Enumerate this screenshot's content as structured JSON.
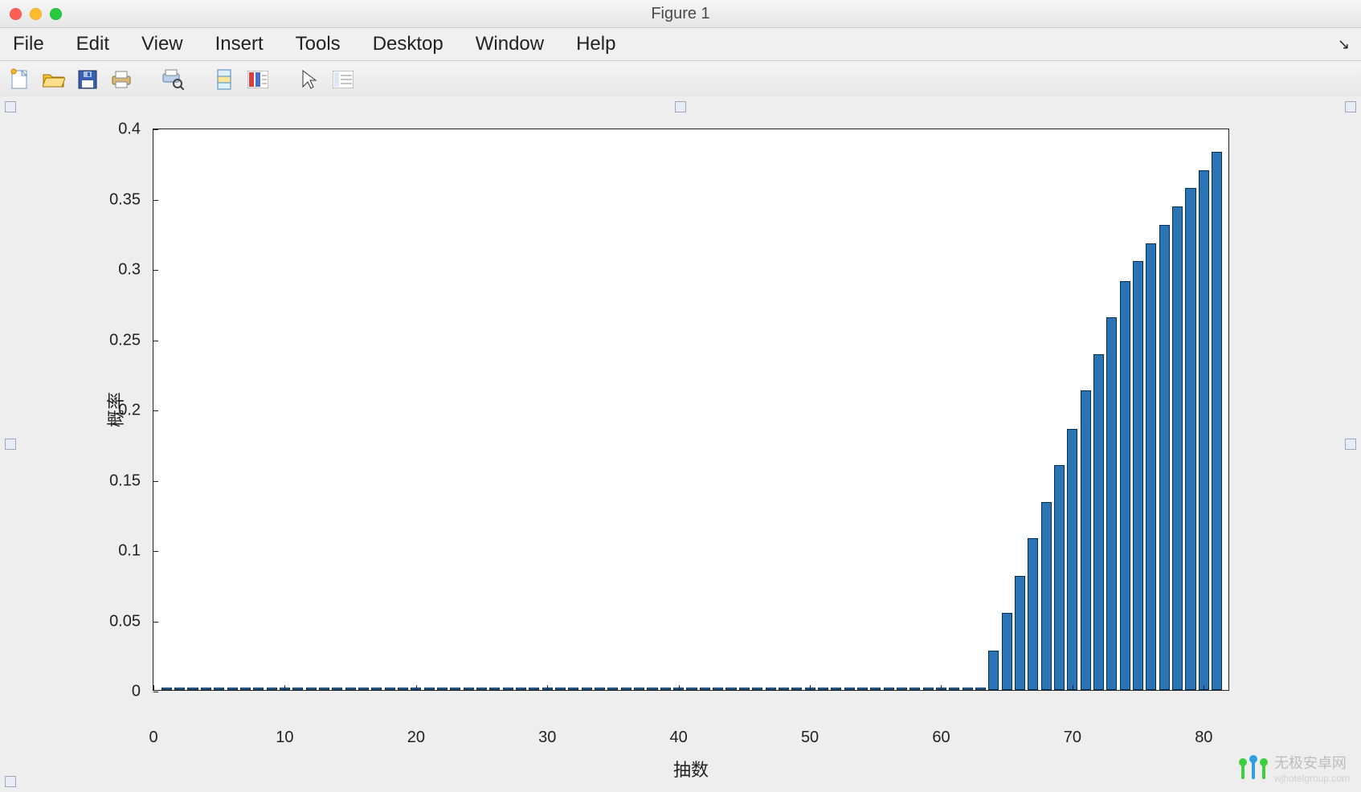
{
  "window": {
    "title": "Figure 1"
  },
  "menubar": {
    "items": [
      "File",
      "Edit",
      "View",
      "Insert",
      "Tools",
      "Desktop",
      "Window",
      "Help"
    ]
  },
  "toolbar": {
    "icons": [
      "new-figure-icon",
      "open-file-icon",
      "save-icon",
      "print-icon",
      "sep",
      "print-preview-icon",
      "sep",
      "link-plot-icon",
      "colorbar-icon",
      "sep",
      "cursor-icon",
      "plot-tools-icon"
    ]
  },
  "chart_data": {
    "type": "bar",
    "xlabel": "抽数",
    "ylabel": "概率",
    "xlim": [
      0,
      82
    ],
    "ylim": [
      0,
      0.4
    ],
    "xticks": [
      0,
      10,
      20,
      30,
      40,
      50,
      60,
      70,
      80
    ],
    "yticks": [
      0,
      0.05,
      0.1,
      0.15,
      0.2,
      0.25,
      0.3,
      0.35,
      0.4
    ],
    "bar_color": "#2a73b5",
    "categories": [
      1,
      2,
      3,
      4,
      5,
      6,
      7,
      8,
      9,
      10,
      11,
      12,
      13,
      14,
      15,
      16,
      17,
      18,
      19,
      20,
      21,
      22,
      23,
      24,
      25,
      26,
      27,
      28,
      29,
      30,
      31,
      32,
      33,
      34,
      35,
      36,
      37,
      38,
      39,
      40,
      41,
      42,
      43,
      44,
      45,
      46,
      47,
      48,
      49,
      50,
      51,
      52,
      53,
      54,
      55,
      56,
      57,
      58,
      59,
      60,
      61,
      62,
      63,
      64,
      65,
      66,
      67,
      68,
      69,
      70,
      71,
      72,
      73,
      74,
      75,
      76,
      77,
      78,
      79,
      80,
      81
    ],
    "values": [
      0.002,
      0.002,
      0.002,
      0.002,
      0.002,
      0.002,
      0.002,
      0.002,
      0.002,
      0.002,
      0.002,
      0.002,
      0.002,
      0.002,
      0.002,
      0.002,
      0.002,
      0.002,
      0.002,
      0.002,
      0.002,
      0.002,
      0.002,
      0.002,
      0.002,
      0.002,
      0.002,
      0.002,
      0.002,
      0.002,
      0.002,
      0.002,
      0.002,
      0.002,
      0.002,
      0.002,
      0.002,
      0.002,
      0.002,
      0.002,
      0.002,
      0.002,
      0.002,
      0.002,
      0.002,
      0.002,
      0.002,
      0.002,
      0.002,
      0.002,
      0.002,
      0.002,
      0.002,
      0.002,
      0.002,
      0.002,
      0.002,
      0.002,
      0.002,
      0.002,
      0.002,
      0.002,
      0.002,
      0.028,
      0.055,
      0.081,
      0.108,
      0.134,
      0.16,
      0.186,
      0.213,
      0.239,
      0.265,
      0.291,
      0.305,
      0.318,
      0.331,
      0.344,
      0.357,
      0.37,
      0.383
    ]
  },
  "watermark": {
    "text": "无极安卓网",
    "sub": "wjhotelgroup.com"
  }
}
